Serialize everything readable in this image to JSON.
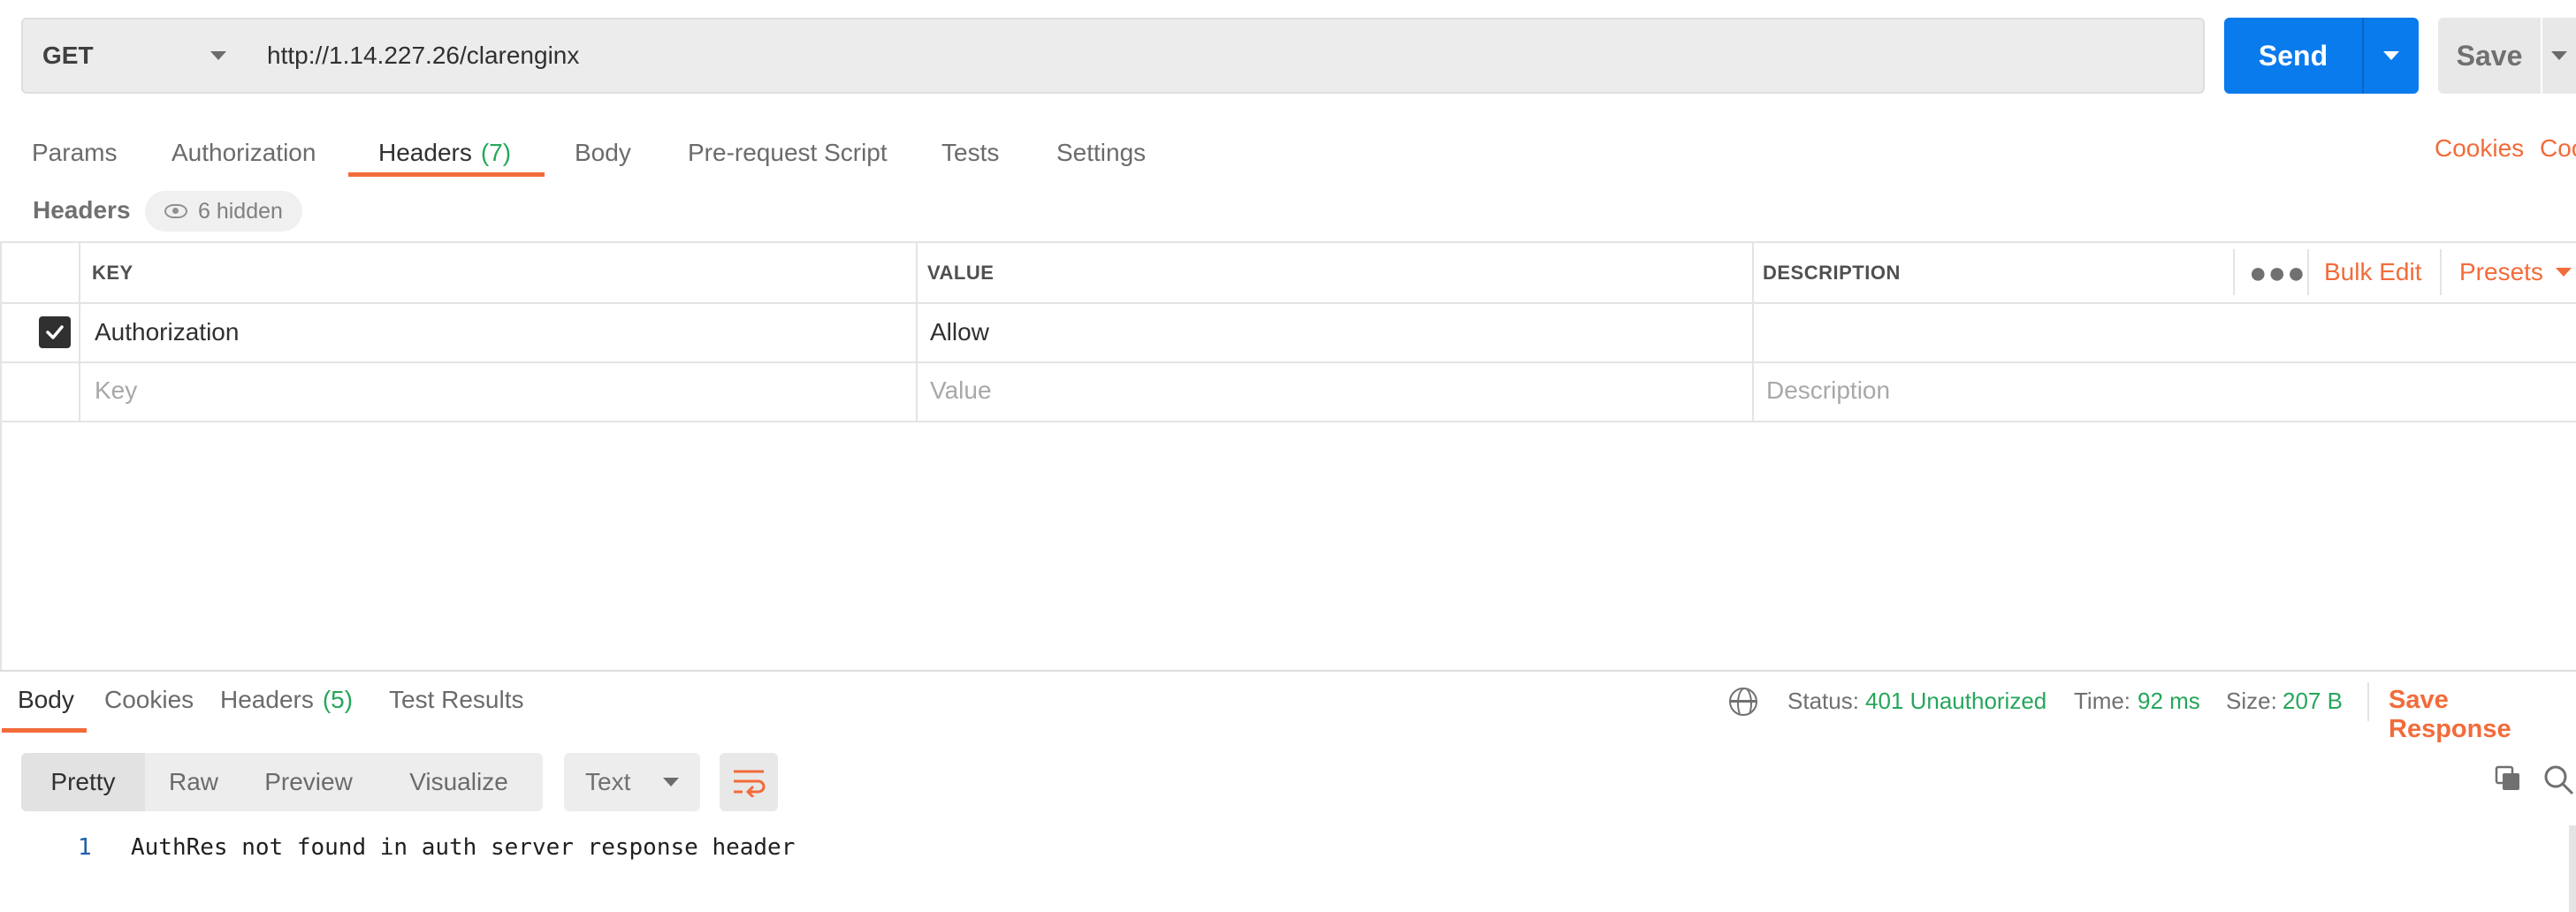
{
  "request": {
    "method": "GET",
    "url": "http://1.14.227.26/clarenginx",
    "send_label": "Send",
    "save_label": "Save"
  },
  "request_tabs": [
    {
      "label": "Params"
    },
    {
      "label": "Authorization"
    },
    {
      "label": "Headers",
      "count": "(7)",
      "active": true
    },
    {
      "label": "Body"
    },
    {
      "label": "Pre-request Script"
    },
    {
      "label": "Tests"
    },
    {
      "label": "Settings"
    }
  ],
  "right_links": {
    "cookies": "Cookies",
    "code": "Coc"
  },
  "headers_section": {
    "title": "Headers",
    "hidden_label": "6 hidden"
  },
  "table": {
    "columns": {
      "key": "KEY",
      "value": "VALUE",
      "description": "DESCRIPTION"
    },
    "bulk_edit": "Bulk Edit",
    "presets": "Presets",
    "rows": [
      {
        "key": "Authorization",
        "value": "Allow",
        "description": "",
        "checked": true
      }
    ],
    "placeholders": {
      "key": "Key",
      "value": "Value",
      "description": "Description"
    }
  },
  "response": {
    "tabs": [
      {
        "label": "Body",
        "active": true
      },
      {
        "label": "Cookies"
      },
      {
        "label": "Headers",
        "count": "(5)"
      },
      {
        "label": "Test Results"
      }
    ],
    "status_label": "Status:",
    "status_value": "401 Unauthorized",
    "time_label": "Time:",
    "time_value": "92 ms",
    "size_label": "Size:",
    "size_value": "207 B",
    "save_response": "Save Response",
    "view_modes": [
      "Pretty",
      "Raw",
      "Preview",
      "Visualize"
    ],
    "format": "Text",
    "lines": [
      {
        "no": "1",
        "text": "AuthRes not found in auth server response header"
      }
    ]
  },
  "colors": {
    "accent": "#f26b3a",
    "send": "#097bed",
    "success": "#26a65b"
  },
  "icons": [
    "chevron-down-icon",
    "eye-icon",
    "checkmark-icon",
    "more-icon",
    "globe-icon",
    "wrap-lines-icon",
    "copy-icon",
    "search-icon"
  ]
}
